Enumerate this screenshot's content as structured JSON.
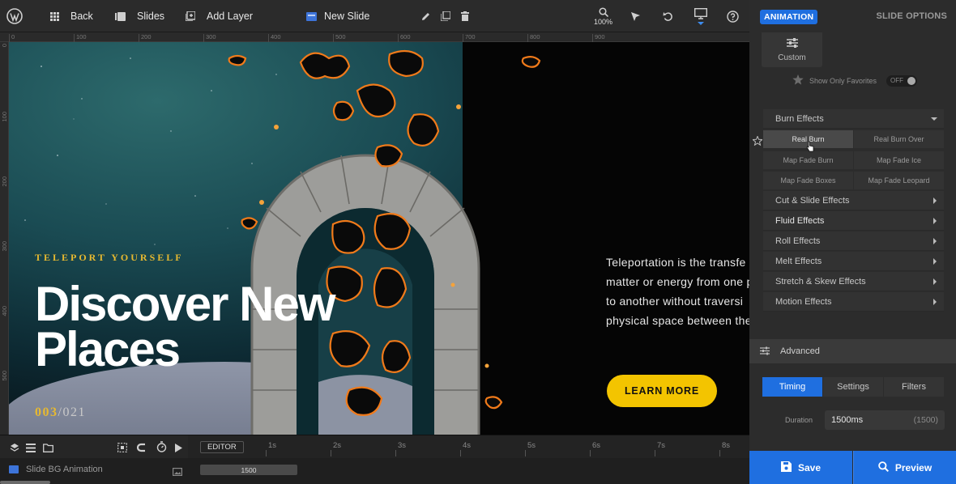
{
  "toolbar": {
    "back_label": "Back",
    "slides_label": "Slides",
    "add_layer_label": "Add Layer",
    "slide_name": "New Slide",
    "zoom_label": "100%"
  },
  "ruler": {
    "top_labels": [
      "0",
      "100",
      "200",
      "300",
      "400",
      "500",
      "600",
      "700",
      "800",
      "900"
    ],
    "left_labels": [
      "0",
      "100",
      "200",
      "300",
      "400",
      "500"
    ]
  },
  "slide": {
    "eyebrow": "TELEPORT YOURSELF",
    "headline": "Discover New Places",
    "counter_current": "003",
    "counter_total": "/021",
    "body_text": "Teleportation is the transfe\nmatter or energy from one p\nto another without traversi\nphysical space between the",
    "cta_label": "LEARN MORE"
  },
  "timeline": {
    "editor_label": "EDITOR",
    "seconds": [
      "1s",
      "2s",
      "3s",
      "4s",
      "5s",
      "6s",
      "7s",
      "8s"
    ],
    "layer_name": "Slide BG Animation",
    "bar_value": "1500"
  },
  "panel": {
    "tab_animation": "ANIMATION",
    "tab_slide_options": "SLIDE OPTIONS",
    "custom_label": "Custom",
    "favorites_label": "Show Only Favorites",
    "favorites_toggle": "OFF",
    "open_category": "Burn Effects",
    "burn_effects": [
      "Real Burn",
      "Real Burn Over",
      "Map Fade Burn",
      "Map Fade Ice",
      "Map Fade Boxes",
      "Map Fade Leopard"
    ],
    "selected_effect": "Real Burn",
    "categories": [
      "Cut & Slide Effects",
      "Fluid Effects",
      "Roll Effects",
      "Melt Effects",
      "Stretch & Skew Effects",
      "Motion Effects"
    ],
    "advanced_label": "Advanced",
    "subtabs": [
      "Timing",
      "Settings",
      "Filters"
    ],
    "active_subtab": "Timing",
    "duration_label": "Duration",
    "duration_value": "1500ms",
    "duration_hint": "(1500)",
    "save_label": "Save",
    "preview_label": "Preview"
  },
  "colors": {
    "accent": "#1f6fe0",
    "slide_gold": "#e7b930",
    "cta_yellow": "#f3c400",
    "fire": "#f07a1a"
  }
}
